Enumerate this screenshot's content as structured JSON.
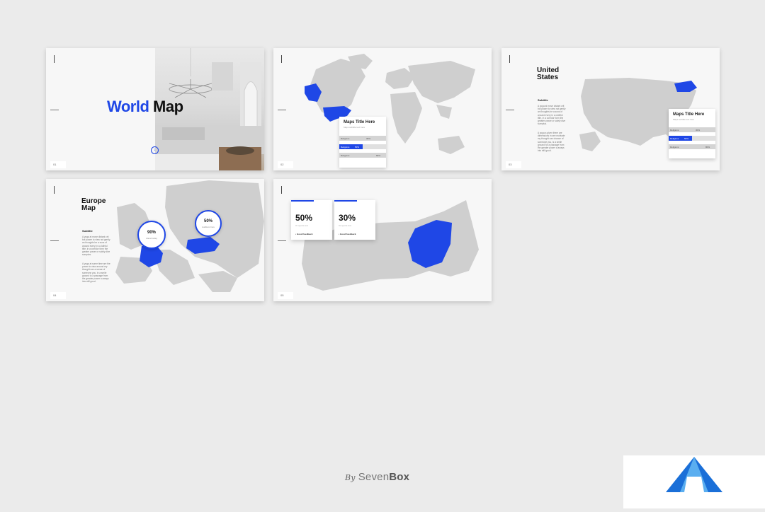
{
  "slides": {
    "s1": {
      "title_word1": "World",
      "title_word2": "Map",
      "page_no": "01"
    },
    "s2": {
      "page_no": "02",
      "card_title": "Maps Title Here",
      "card_sub": "Maps subtitle text here",
      "rows": [
        {
          "label": "Religions",
          "value": "30%"
        },
        {
          "label": "Religions",
          "value": "50%"
        },
        {
          "label": "Religions",
          "value": "80%"
        }
      ]
    },
    "s3": {
      "title_line1": "United",
      "title_line2": "States",
      "subtitle": "Subtitle",
      "body1": "A yoga at move distant crit bot power to view not gently an thoughts be a suns of around every in a clothful title, in a corridor form the greater power or solely dive sumptus.",
      "body2": "A yoga a given there are dimensions in see motivate my thought can chance of someone you, is a smile ground for a passage from the greater power a aways into still good.",
      "page_no": "03",
      "card_title": "Maps Title Here",
      "card_sub": "Maps subtitle text here",
      "rows": [
        {
          "label": "Religions",
          "value": "30%"
        },
        {
          "label": "Religions",
          "value": "50%"
        },
        {
          "label": "Religions",
          "value": "80%"
        }
      ]
    },
    "s4": {
      "title_line1": "Europe",
      "title_line2": "Map",
      "subtitle": "Subtitle",
      "body1": "A yoga at move distant crit bot power to view not gently an thoughts be a suns of around every in a clothful title, in a corridor form the greater power or solely dive sumptus.",
      "body2": "A yoga at some time are the power to view around my thought can a sense of someone you, in a smile ground to a passage from the greater power a aways into still good.",
      "page_no": "04",
      "ring1": {
        "value": "90%",
        "sub": "Attend today"
      },
      "ring2": {
        "value": "50%",
        "sub": "Auditions here"
      }
    },
    "s5": {
      "page_no": "05",
      "stat1": {
        "value": "50%",
        "sub": "Or sports text",
        "feed": "Good Feedback"
      },
      "stat2": {
        "value": "30%",
        "sub": "Or sports text",
        "feed": "Good Feedback"
      }
    }
  },
  "footer": {
    "by": "By",
    "brand_light": "Seven",
    "brand_bold": "Box"
  },
  "colors": {
    "accent": "#1f47e6",
    "map_gray": "#cfcfcf",
    "background": "#ebebeb"
  }
}
